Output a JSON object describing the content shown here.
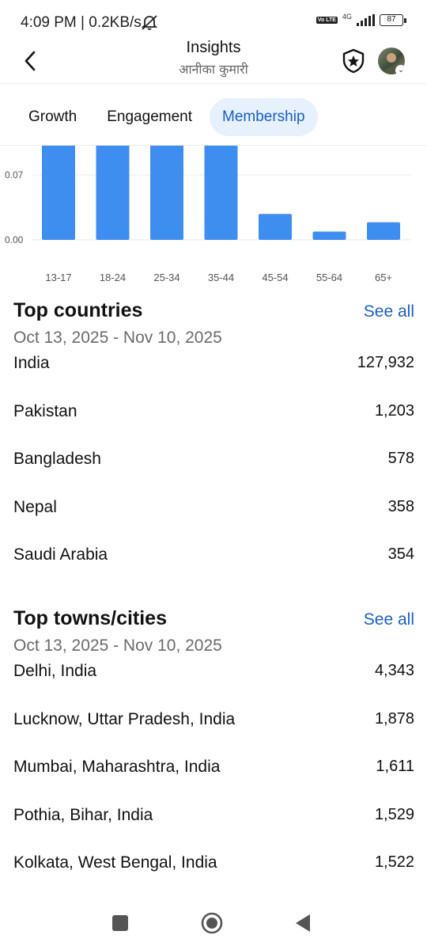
{
  "status_bar": {
    "time_speed": "4:09 PM | 0.2KB/s",
    "network_label": "4G",
    "volte_label": "Vo LTE",
    "battery": "87"
  },
  "header": {
    "title": "Insights",
    "subtitle": "आनीका कुमारी"
  },
  "tabs": [
    {
      "label": "Growth",
      "active": false
    },
    {
      "label": "Engagement",
      "active": false
    },
    {
      "label": "Membership",
      "active": true
    }
  ],
  "chart_data": {
    "type": "bar",
    "categories": [
      "13-17",
      "18-24",
      "25-34",
      "35-44",
      "45-54",
      "55-64",
      "65+"
    ],
    "values": [
      0.15,
      0.15,
      0.15,
      0.129,
      0.028,
      0.009,
      0.019
    ],
    "yticks": [
      {
        "value": 0.07,
        "label": "0.07"
      },
      {
        "value": 0.0,
        "label": "0.00"
      }
    ],
    "ylim": [
      0,
      0.13
    ],
    "bar_color": "#3e8ef0",
    "grid": true
  },
  "top_countries": {
    "title": "Top countries",
    "see_all": "See all",
    "date_range": "Oct 13, 2025 - Nov 10, 2025",
    "rows": [
      {
        "name": "India",
        "value": "127,932"
      },
      {
        "name": "Pakistan",
        "value": "1,203"
      },
      {
        "name": "Bangladesh",
        "value": "578"
      },
      {
        "name": "Nepal",
        "value": "358"
      },
      {
        "name": "Saudi Arabia",
        "value": "354"
      }
    ]
  },
  "top_cities": {
    "title": "Top towns/cities",
    "see_all": "See all",
    "date_range": "Oct 13, 2025 - Nov 10, 2025",
    "rows": [
      {
        "name": "Delhi, India",
        "value": "4,343"
      },
      {
        "name": "Lucknow, Uttar Pradesh, India",
        "value": "1,878"
      },
      {
        "name": "Mumbai, Maharashtra, India",
        "value": "1,611"
      },
      {
        "name": "Pothia, Bihar, India",
        "value": "1,529"
      },
      {
        "name": "Kolkata, West Bengal, India",
        "value": "1,522"
      }
    ]
  },
  "colors": {
    "accent": "#1a5ec7",
    "tab_active_bg": "#e6f1fd",
    "bar": "#3e8ef0"
  }
}
